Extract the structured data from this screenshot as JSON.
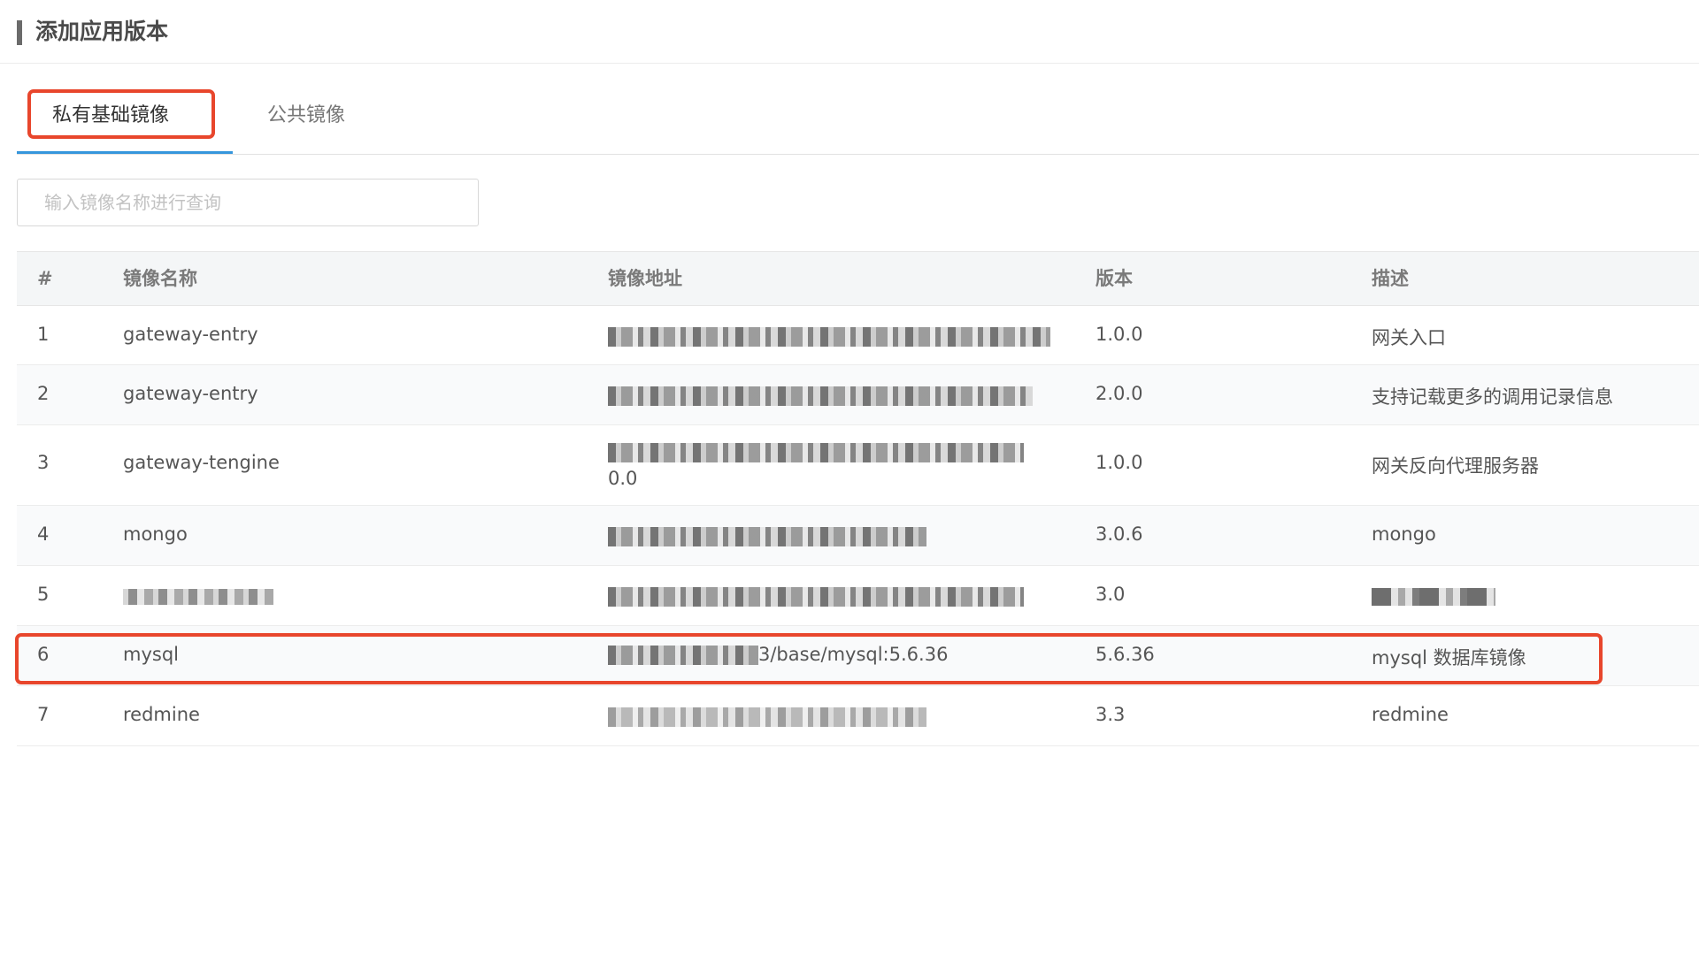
{
  "header": {
    "title": "添加应用版本"
  },
  "tabs": [
    {
      "label": "私有基础镜像",
      "active": true
    },
    {
      "label": "公共镜像",
      "active": false
    }
  ],
  "search": {
    "placeholder": "输入镜像名称进行查询",
    "value": ""
  },
  "table": {
    "columns": [
      "#",
      "镜像名称",
      "镜像地址",
      "版本",
      "描述"
    ],
    "rows": [
      {
        "index": "1",
        "name": "gateway-entry",
        "address_visible": "",
        "version": "1.0.0",
        "description": "网关入口"
      },
      {
        "index": "2",
        "name": "gateway-entry",
        "address_visible": "",
        "version": "2.0.0",
        "description": "支持记载更多的调用记录信息"
      },
      {
        "index": "3",
        "name": "gateway-tengine",
        "address_visible": "0.0",
        "version": "1.0.0",
        "description": "网关反向代理服务器"
      },
      {
        "index": "4",
        "name": "mongo",
        "address_visible": "",
        "version": "3.0.6",
        "description": "mongo"
      },
      {
        "index": "5",
        "name": "",
        "address_visible": "",
        "version": "3.0",
        "description": ""
      },
      {
        "index": "6",
        "name": "mysql",
        "address_visible": "3/base/mysql:5.6.36",
        "version": "5.6.36",
        "description": "mysql 数据库镜像",
        "highlighted": true
      },
      {
        "index": "7",
        "name": "redmine",
        "address_visible": "",
        "version": "3.3",
        "description": "redmine"
      }
    ]
  },
  "colors": {
    "highlight": "#e8462c",
    "tab_underline": "#3596dc",
    "header_background": "#f4f6f7"
  }
}
